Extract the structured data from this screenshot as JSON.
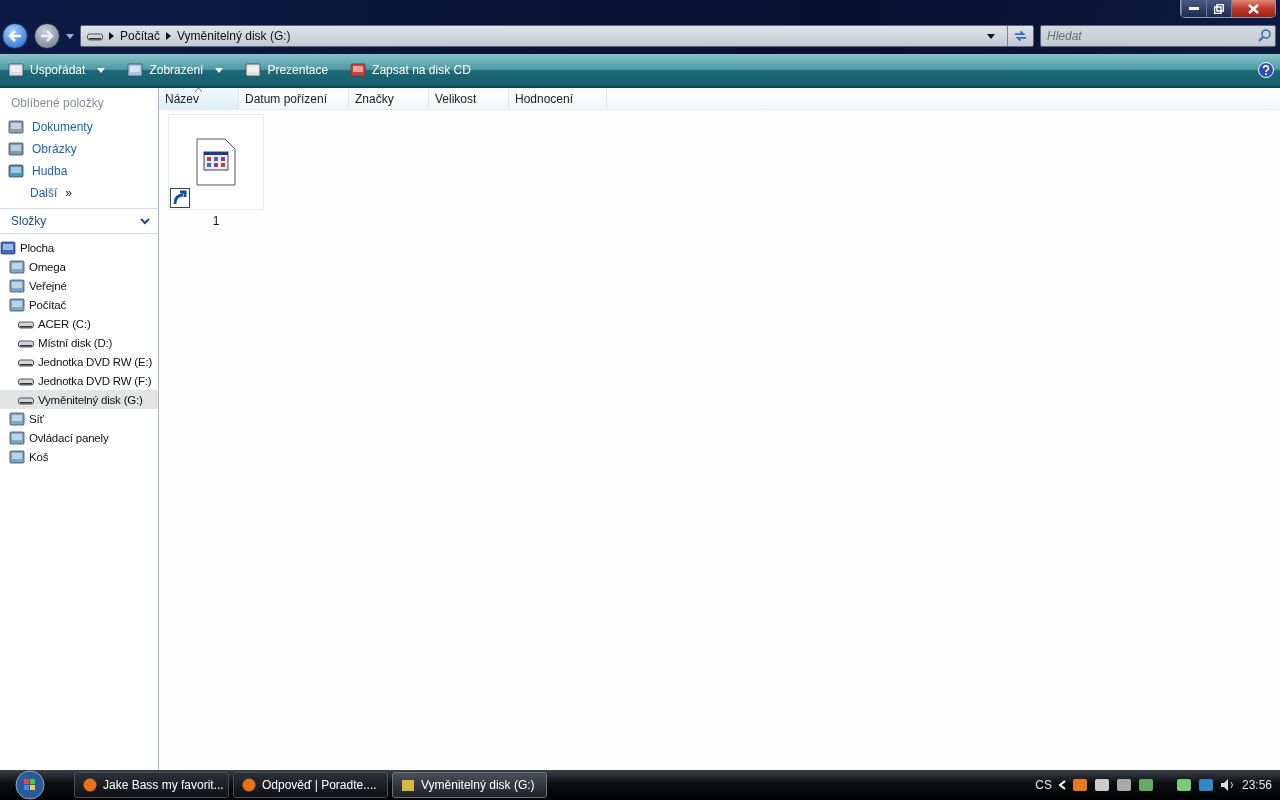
{
  "address": {
    "crumbs": [
      "Počítač",
      "Vyměnitelný disk (G:)"
    ]
  },
  "search": {
    "placeholder": "Hledat"
  },
  "toolbar": [
    {
      "label": "Uspořádat",
      "dropdown": true
    },
    {
      "label": "Zobrazení",
      "dropdown": true
    },
    {
      "label": "Prezentace",
      "dropdown": false
    },
    {
      "label": "Zapsat na disk CD",
      "dropdown": false
    }
  ],
  "favorites": {
    "title": "Oblíbené položky",
    "items": [
      "Dokumenty",
      "Obrázky",
      "Hudba"
    ],
    "more": "Další",
    "more_mark": "»"
  },
  "folders": {
    "title": "Složky",
    "expanded": true,
    "tree": [
      {
        "label": "Plocha",
        "selected": false,
        "children": [
          {
            "label": "Omega",
            "selected": false
          },
          {
            "label": "Veřejné",
            "selected": false
          },
          {
            "label": "Počítač",
            "selected": false,
            "children": [
              {
                "label": "ACER (C:)",
                "selected": false
              },
              {
                "label": "Místní disk (D:)",
                "selected": false
              },
              {
                "label": "Jednotka DVD RW (E:)",
                "selected": false
              },
              {
                "label": "Jednotka DVD RW (F:)",
                "selected": false
              },
              {
                "label": "Vyměnitelný disk (G:)",
                "selected": true
              }
            ]
          },
          {
            "label": "Síť",
            "selected": false
          },
          {
            "label": "Ovládací panely",
            "selected": false
          },
          {
            "label": "Koš",
            "selected": false
          }
        ]
      }
    ]
  },
  "columns": [
    {
      "label": "Název",
      "selected": true
    },
    {
      "label": "Datum pořízení",
      "selected": false
    },
    {
      "label": "Značky",
      "selected": false
    },
    {
      "label": "Velikost",
      "selected": false
    },
    {
      "label": "Hodnocení",
      "selected": false
    }
  ],
  "files": [
    {
      "name": "1",
      "shortcut": true
    }
  ],
  "taskbar": {
    "buttons": [
      {
        "label": "Jake Bass my favorit...",
        "selected": false
      },
      {
        "label": "Odpověď | Poradte....",
        "selected": false
      },
      {
        "label": "Vyměnitelný disk (G:)",
        "selected": true
      }
    ],
    "language": "CS",
    "clock": "23:56"
  }
}
